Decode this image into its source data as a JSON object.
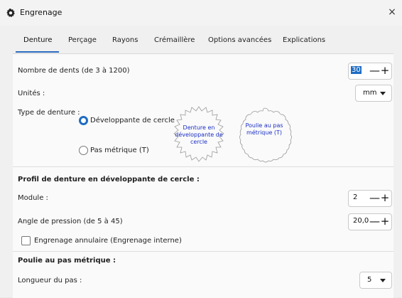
{
  "window": {
    "title": "Engrenage",
    "close_glyph": "×"
  },
  "tabs": [
    {
      "label": "Denture",
      "active": true
    },
    {
      "label": "Perçage"
    },
    {
      "label": "Rayons"
    },
    {
      "label": "Crémaillère"
    },
    {
      "label": "Options avancées"
    },
    {
      "label": "Explications"
    }
  ],
  "denture": {
    "num_teeth_label": "Nombre de dents (de 3 à 1200)",
    "num_teeth_value": "30",
    "units_label": "Unités :",
    "units_value": "mm",
    "type_label": "Type de denture :",
    "option_involute": "Développante de cercle",
    "option_pitch": "Pas métrique (T)",
    "involute_gear_label": "Denture en développante de cercle",
    "pitch_gear_label": "Poulie au pas métrique (T)"
  },
  "involute_section": {
    "heading": "Profil de denture en développante de cercle :",
    "module_label": "Module :",
    "module_value": "2",
    "pressure_label": "Angle de pression (de 5 à 45)",
    "pressure_value": "20,0",
    "annular_label": "Engrenage annulaire (Engrenage interne)"
  },
  "pulley_section": {
    "heading": "Poulie au pas métrique :",
    "pitch_length_label": "Longueur du pas :",
    "pitch_length_value": "5"
  },
  "controls": {
    "minus": "—",
    "plus": "+"
  },
  "colors": {
    "accent": "#1f6cc2",
    "gear_text": "#1b2fc4"
  },
  "icons": {
    "app": "gear-icon",
    "close": "close-icon",
    "dropdown": "triangle-down-icon"
  }
}
